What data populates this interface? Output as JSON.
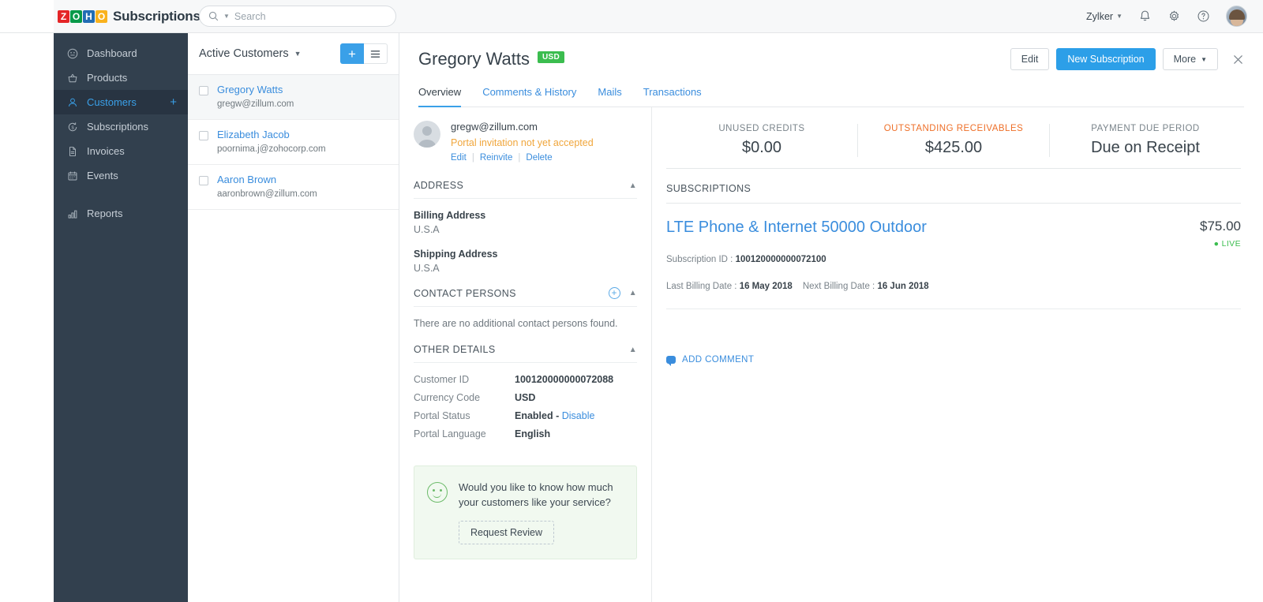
{
  "app": {
    "brand_name": "Subscriptions",
    "logo_letters": [
      "Z",
      "O",
      "H",
      "O"
    ]
  },
  "search": {
    "placeholder": "Search"
  },
  "topbar": {
    "org_name": "Zylker",
    "icons": [
      "bell-icon",
      "gear-icon",
      "help-icon",
      "avatar"
    ]
  },
  "sidebar": {
    "items": [
      {
        "label": "Dashboard",
        "icon": "dashboard-icon",
        "active": false
      },
      {
        "label": "Products",
        "icon": "basket-icon",
        "active": false
      },
      {
        "label": "Customers",
        "icon": "user-icon",
        "active": true,
        "has_plus": true
      },
      {
        "label": "Subscriptions",
        "icon": "refresh-dollar-icon",
        "active": false
      },
      {
        "label": "Invoices",
        "icon": "document-icon",
        "active": false
      },
      {
        "label": "Events",
        "icon": "calendar-icon",
        "active": false
      },
      {
        "label": "Reports",
        "icon": "bar-chart-icon",
        "active": false
      }
    ]
  },
  "list_pane": {
    "filter_label": "Active Customers",
    "add_label": "+",
    "customers": [
      {
        "name": "Gregory Watts",
        "email": "gregw@zillum.com",
        "selected": true
      },
      {
        "name": "Elizabeth Jacob",
        "email": "poornima.j@zohocorp.com",
        "selected": false
      },
      {
        "name": "Aaron Brown",
        "email": "aaronbrown@zillum.com",
        "selected": false
      }
    ]
  },
  "detail": {
    "customer_name": "Gregory Watts",
    "currency_badge": "USD",
    "actions": {
      "edit": "Edit",
      "new_subscription": "New Subscription",
      "more": "More"
    },
    "tabs": [
      {
        "label": "Overview",
        "active": true
      },
      {
        "label": "Comments & History",
        "active": false
      },
      {
        "label": "Mails",
        "active": false
      },
      {
        "label": "Transactions",
        "active": false
      }
    ],
    "contact": {
      "email": "gregw@zillum.com",
      "portal_warning": "Portal invitation not yet accepted",
      "links": [
        "Edit",
        "Reinvite",
        "Delete"
      ]
    },
    "address": {
      "section_title": "ADDRESS",
      "billing_label": "Billing Address",
      "billing_value": "U.S.A",
      "shipping_label": "Shipping Address",
      "shipping_value": "U.S.A"
    },
    "contact_persons": {
      "section_title": "CONTACT PERSONS",
      "empty_text": "There are no additional contact persons found."
    },
    "other_details": {
      "section_title": "OTHER DETAILS",
      "rows": [
        {
          "key": "Customer ID",
          "value": "100120000000072088"
        },
        {
          "key": "Currency Code",
          "value": "USD"
        },
        {
          "key": "Portal Status",
          "value": "Enabled - ",
          "link": "Disable"
        },
        {
          "key": "Portal Language",
          "value": "English"
        }
      ]
    },
    "review_card": {
      "message": "Would you like to know how much your customers like your service?",
      "button_label": "Request Review"
    },
    "stats": [
      {
        "label": "UNUSED CREDITS",
        "value": "$0.00",
        "highlight": false
      },
      {
        "label": "OUTSTANDING RECEIVABLES",
        "value": "$425.00",
        "highlight": true
      },
      {
        "label": "PAYMENT DUE PERIOD",
        "value": "Due on Receipt",
        "highlight": false
      }
    ],
    "subscriptions": {
      "section_title": "SUBSCRIPTIONS",
      "items": [
        {
          "name": "LTE Phone & Internet 50000 Outdoor",
          "price": "$75.00",
          "status": "LIVE",
          "id_label": "Subscription ID : ",
          "id_value": "100120000000072100",
          "last_billing_label": "Last Billing Date : ",
          "last_billing_value": "16 May 2018",
          "next_billing_label": "Next Billing Date : ",
          "next_billing_value": "16 Jun 2018"
        }
      ]
    },
    "add_comment_label": "ADD COMMENT"
  },
  "colors": {
    "accent_blue": "#3aa0e8",
    "link_blue": "#3a8ddd",
    "sidebar_bg": "#32404e",
    "green": "#3bbd4f",
    "orange": "#ee6f28",
    "warning": "#f0a63c"
  }
}
